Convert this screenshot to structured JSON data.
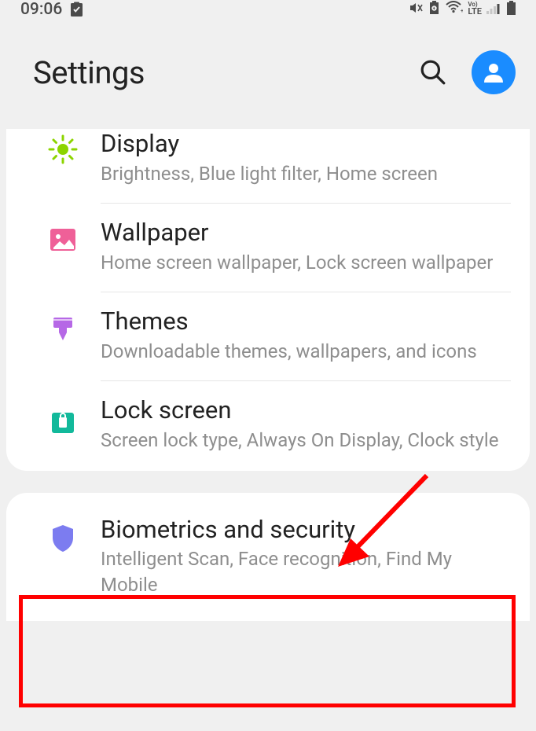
{
  "status": {
    "time": "09:06",
    "network": "LTE"
  },
  "header": {
    "title": "Settings"
  },
  "group1": [
    {
      "title": "Display",
      "desc": "Brightness, Blue light filter, Home screen"
    },
    {
      "title": "Wallpaper",
      "desc": "Home screen wallpaper, Lock screen wallpaper"
    },
    {
      "title": "Themes",
      "desc": "Downloadable themes, wallpapers, and icons"
    },
    {
      "title": "Lock screen",
      "desc": "Screen lock type, Always On Display, Clock style"
    }
  ],
  "group2": [
    {
      "title": "Biometrics and security",
      "desc": "Intelligent Scan, Face recognition, Find My Mobile"
    }
  ],
  "colors": {
    "display": "#8cd400",
    "wallpaper": "#ef6098",
    "themes": "#b668e6",
    "lockscreen": "#12b99b",
    "biometrics": "#7c7cf0",
    "avatar": "#1a8cff",
    "annotation": "#ff0000"
  }
}
